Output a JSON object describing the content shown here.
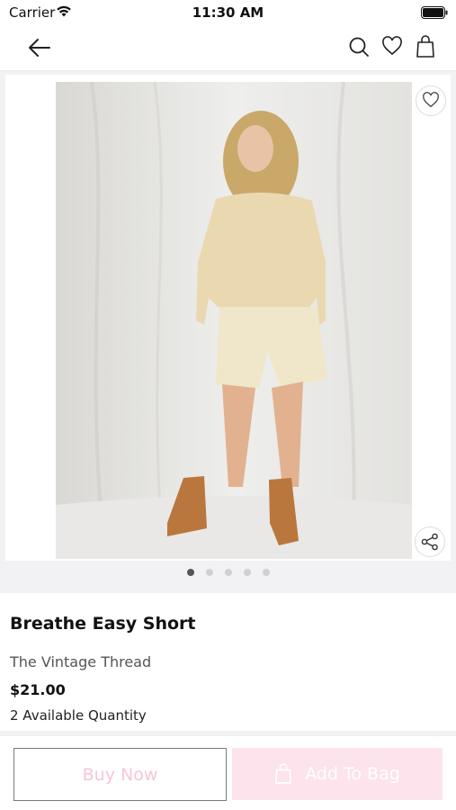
{
  "status_bar": {
    "carrier": "Carrier",
    "time": "11:30 AM"
  },
  "navbar": {
    "icons": [
      "back-arrow-icon",
      "search-icon",
      "heart-icon",
      "shopping-bag-icon"
    ]
  },
  "gallery": {
    "page_count": 5,
    "active_index": 0,
    "overlay_icons": [
      "heart-icon",
      "share-icon"
    ]
  },
  "product": {
    "title": "Breathe Easy Short",
    "brand": "The Vintage Thread",
    "price": "$21.00",
    "quantity": "2 Available Quantity"
  },
  "actions": {
    "buy_now": "Buy Now",
    "add_to_bag": "Add To Bag"
  },
  "colors": {
    "accent_pink": "#fde3ec",
    "buy_text": "#f7c6d6"
  }
}
